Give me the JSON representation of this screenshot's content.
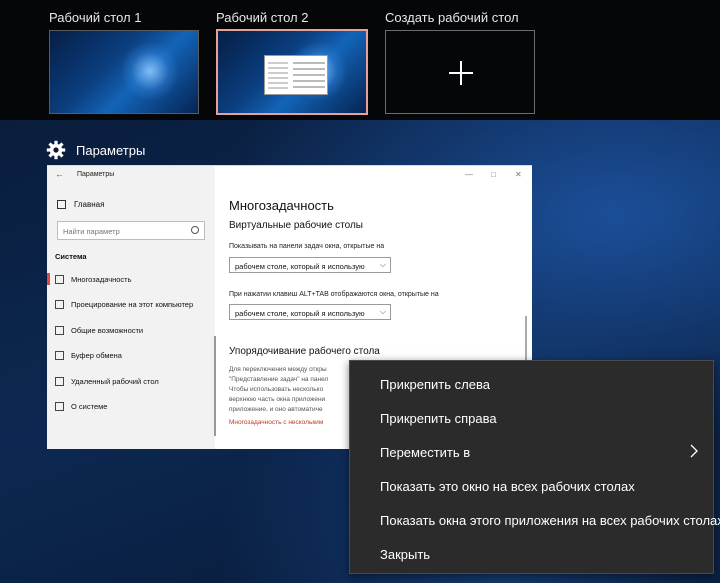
{
  "desktops": [
    {
      "title": "Рабочий стол 1",
      "active": false
    },
    {
      "title": "Рабочий стол 2",
      "active": true
    },
    {
      "title": "Создать рабочий стол",
      "kind": "new",
      "icon": "plus-icon"
    }
  ],
  "window_label": {
    "icon": "gear-icon",
    "title": "Параметры"
  },
  "settings_window": {
    "title": "Параметры",
    "home": "Главная",
    "search_placeholder": "Найти параметр",
    "section": "Система",
    "nav": [
      {
        "label": "Многозадачность",
        "icon": "multitask-icon",
        "active": true
      },
      {
        "label": "Проецирование на этот компьютер",
        "icon": "projection-icon"
      },
      {
        "label": "Общие возможности",
        "icon": "shared-experiences-icon"
      },
      {
        "label": "Буфер обмена",
        "icon": "clipboard-icon"
      },
      {
        "label": "Удаленный рабочий стол",
        "icon": "remote-desktop-icon"
      },
      {
        "label": "О системе",
        "icon": "info-icon"
      }
    ],
    "heading": "Многозадачность",
    "subheading": "Виртуальные рабочие столы",
    "taskbar_label": "Показывать на панели задач окна, открытые на",
    "taskbar_value": "рабочем столе, который я использую",
    "alttab_label": "При нажатии клавиш ALT+TAB отображаются окна, открытые на",
    "alttab_value": "рабочем столе, который я использую",
    "arrange_heading": "Упорядочивание рабочего стола",
    "arrange_text": [
      "Для переключения между откры",
      "\"Представление задач\" на панел",
      "Чтобы использовать несколько",
      "верхнюю часть окна приложени",
      "приложение, и оно автоматиче"
    ],
    "arrange_link": "Многозадачность с нескольким"
  },
  "context_menu": {
    "items": [
      {
        "label": "Прикрепить слева"
      },
      {
        "label": "Прикрепить справа"
      },
      {
        "label": "Переместить в",
        "submenu": true
      },
      {
        "label": "Показать это окно на всех рабочих столах"
      },
      {
        "label": "Показать окна этого приложения на всех рабочих столах"
      },
      {
        "label": "Закрыть"
      }
    ]
  },
  "colors": {
    "active_desktop_border": "#e7a09a",
    "menu_background": "#2b2b2b",
    "accent_nav_marker": "#e2454b",
    "link": "#c0392b"
  }
}
